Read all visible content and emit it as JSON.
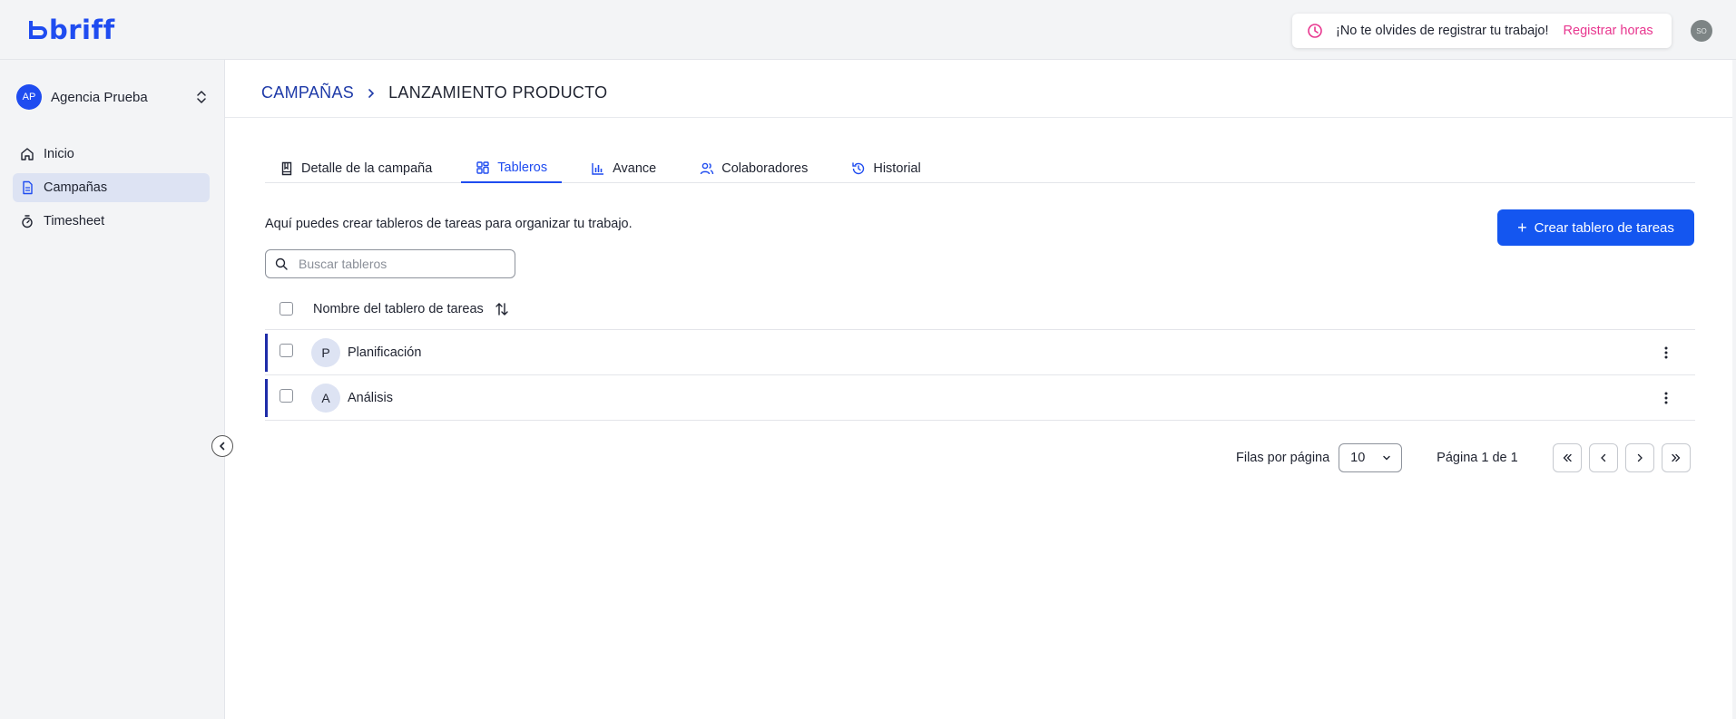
{
  "topbar": {
    "logo_text": "briff",
    "reminder_text": "¡No te olvides de registrar tu trabajo!",
    "reminder_link": "Registrar horas",
    "user_initials": "SO"
  },
  "sidebar": {
    "org_initials": "AP",
    "org_name": "Agencia Prueba",
    "items": [
      {
        "label": "Inicio",
        "icon": "home-icon"
      },
      {
        "label": "Campañas",
        "icon": "document-icon",
        "active": true
      },
      {
        "label": "Timesheet",
        "icon": "stopwatch-icon"
      }
    ]
  },
  "breadcrumb": {
    "parent": "CAMPAÑAS",
    "current": "LANZAMIENTO PRODUCTO"
  },
  "tabs": [
    {
      "label": "Detalle de la campaña",
      "icon": "book-icon"
    },
    {
      "label": "Tableros",
      "icon": "grid-icon",
      "active": true
    },
    {
      "label": "Avance",
      "icon": "bar-chart-icon"
    },
    {
      "label": "Colaboradores",
      "icon": "users-icon"
    },
    {
      "label": "Historial",
      "icon": "history-icon"
    }
  ],
  "boards": {
    "intro": "Aquí puedes crear tableros de tareas para organizar tu trabajo.",
    "create_label": "Crear tablero de tareas",
    "search_placeholder": "Buscar tableros",
    "column_header": "Nombre del tablero de tareas",
    "rows": [
      {
        "initial": "P",
        "name": "Planificación"
      },
      {
        "initial": "A",
        "name": "Análisis"
      }
    ]
  },
  "pagination": {
    "rows_label": "Filas por página",
    "rows_value": "10",
    "page_info": "Página 1 de 1"
  },
  "colors": {
    "brand": "#1f4cf0",
    "link_pink": "#e8368f",
    "row_accent": "#1e2ca8"
  }
}
